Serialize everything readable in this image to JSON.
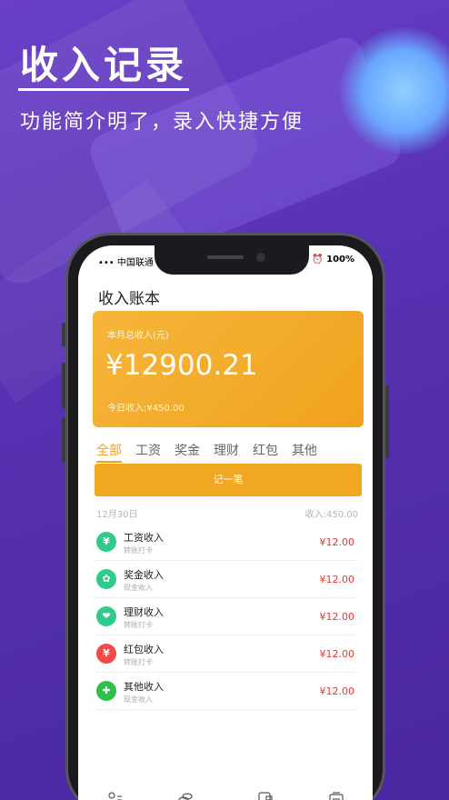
{
  "hero": {
    "title": "收入记录",
    "subtitle": "功能简介明了，录入快捷方便"
  },
  "status_bar": {
    "carrier": "••• 中国联通",
    "battery": "⏰ 100%"
  },
  "app": {
    "title": "收入账本",
    "summary": {
      "label": "本月总收入(元)",
      "amount": "¥12900.21",
      "today": "今日收入:¥450.00"
    },
    "tabs": [
      "全部",
      "工资",
      "奖金",
      "理财",
      "红包",
      "其他"
    ],
    "active_tab": "全部",
    "record_button": "记一笔",
    "day": {
      "date": "12月30日",
      "total": "收入:450.00"
    },
    "entries": [
      {
        "name": "工资收入",
        "note": "转账打卡",
        "amount": "¥12.00",
        "icon": "salary-icon",
        "color": "#2ecc8a",
        "glyph": "¥"
      },
      {
        "name": "奖金收入",
        "note": "现金收入",
        "amount": "¥12.00",
        "icon": "bonus-icon",
        "color": "#2ecc8a",
        "glyph": "✿"
      },
      {
        "name": "理财收入",
        "note": "转账打卡",
        "amount": "¥12.00",
        "icon": "finance-icon",
        "color": "#2ecc8a",
        "glyph": "❤"
      },
      {
        "name": "红包收入",
        "note": "转账打卡",
        "amount": "¥12.00",
        "icon": "red-packet-icon",
        "color": "#ef4b4b",
        "glyph": "¥"
      },
      {
        "name": "其他收入",
        "note": "现金收入",
        "amount": "¥12.00",
        "icon": "other-icon",
        "color": "#2cc24a",
        "glyph": "✚"
      }
    ]
  },
  "nav_icons": [
    "user-list-icon",
    "coins-icon",
    "wallet-icon",
    "ledger-icon"
  ],
  "colors": {
    "accent": "#f0a21e",
    "background": "#5a36b8",
    "amount": "#e53935"
  }
}
